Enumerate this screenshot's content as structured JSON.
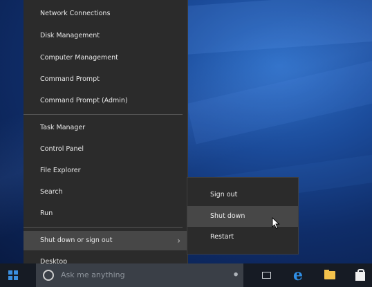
{
  "menu": {
    "items": [
      {
        "label": "Network Connections"
      },
      {
        "label": "Disk Management"
      },
      {
        "label": "Computer Management"
      },
      {
        "label": "Command Prompt"
      },
      {
        "label": "Command Prompt (Admin)"
      },
      {
        "label": "Task Manager"
      },
      {
        "label": "Control Panel"
      },
      {
        "label": "File Explorer"
      },
      {
        "label": "Search"
      },
      {
        "label": "Run"
      },
      {
        "label": "Shut down or sign out",
        "chevron": "›"
      },
      {
        "label": "Desktop"
      }
    ]
  },
  "submenu": {
    "items": [
      {
        "label": "Sign out"
      },
      {
        "label": "Shut down"
      },
      {
        "label": "Restart"
      }
    ]
  },
  "taskbar": {
    "search_placeholder": "Ask me anything",
    "icons": [
      "start-icon",
      "cortana-icon",
      "microphone-icon",
      "task-view-icon",
      "edge-icon",
      "file-explorer-icon",
      "store-icon"
    ]
  },
  "colors": {
    "menu_bg": "#2b2b2b",
    "highlight": "#474747",
    "taskbar_bg": "#161b24",
    "accent": "#2f8fe6"
  }
}
